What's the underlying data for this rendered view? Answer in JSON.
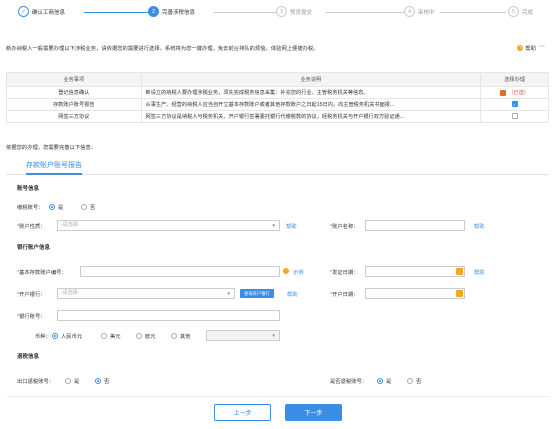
{
  "steps": [
    {
      "num": "✓",
      "label": "确认工商信息",
      "state": "done"
    },
    {
      "num": "2",
      "label": "完善涉税信息",
      "state": "active"
    },
    {
      "num": "3",
      "label": "预览提交",
      "state": "todo"
    },
    {
      "num": "4",
      "label": "审核中",
      "state": "todo"
    },
    {
      "num": "5",
      "label": "完成",
      "state": "todo"
    }
  ],
  "notice": "新办纳税人一般需要办理以下涉税业务，请依据您的需要进行选择，系统将为您一键办理。免去前台排队的烦恼，体验网上便捷办税。",
  "help_label": "帮助",
  "table": {
    "headers": [
      "业务事项",
      "业务说明",
      "选择办理"
    ],
    "rows": [
      {
        "item": "登记信息确认",
        "desc": "新设立的纳税人要办理涉税业务，须先完成税务信息采集：补充您的行业、主管税务机关等信息。",
        "status": "（已选）"
      },
      {
        "item": "存款账户账号报告",
        "desc": "从事生产、经营的纳税人应当自开立基本存款账户或者其他存款账户之日起15日内，向主管税务机关书面报...",
        "status": ""
      },
      {
        "item": "网签三方协议",
        "desc": "网签三方协议是纳税人与税务机关、开户银行签署委托银行代缴税款的协议，经税务机关与开户银行双方验证通...",
        "status": ""
      }
    ]
  },
  "sub_note": "依据您的办理，您需要完善以下信息：",
  "tab_label": "存款账户账号报告",
  "account_section": "账号信息",
  "tax_account_label": "缴税账号：",
  "yes": "是",
  "no": "否",
  "account_type_label": "账户性质：",
  "account_type_placeholder": "-请选择-",
  "help_link": "帮助",
  "account_name_label": "账户名称：",
  "bank_section": "银行账户信息",
  "basic_permit_label": "基本存款账户编号：",
  "example_link": "示例",
  "issue_date_label": "发证日期：",
  "bank_label": "开户银行：",
  "bank_placeholder": "-请选择-",
  "query_bank_btn": "查询开户银行",
  "open_date_label": "开户日期：",
  "bank_account_label": "银行账号：",
  "currency_label": "币种：",
  "currencies": [
    "人民币元",
    "美元",
    "欧元",
    "其他"
  ],
  "refund_section": "退税信息",
  "export_refund_label": "出口退税账号：",
  "is_refund_label": "是否退税账号：",
  "prev_btn": "上一步",
  "next_btn": "下一步",
  "colors": {
    "accent": "#3a8ee6",
    "warn": "#f5a623",
    "danger": "#e94b35"
  }
}
